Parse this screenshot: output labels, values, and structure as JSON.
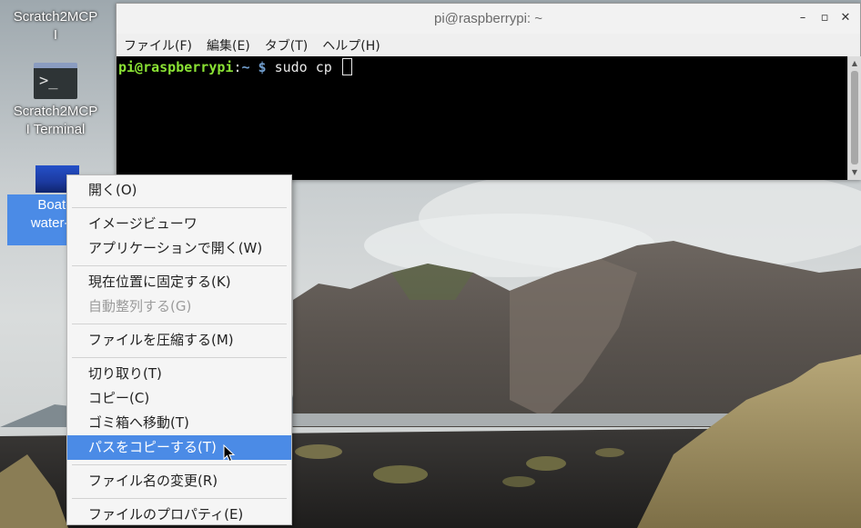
{
  "desktop": {
    "icons": [
      {
        "label": "Scratch2MCP\nI"
      },
      {
        "label": "Scratch2MCP\nI Terminal",
        "glyph": ">_"
      },
      {
        "label": "Boat-s\nwater-pa"
      }
    ]
  },
  "terminal": {
    "title": "pi@raspberrypi: ~",
    "controls": {
      "minimize": "–",
      "maximize": "▫",
      "close": "✕"
    },
    "menu": [
      "ファイル(F)",
      "編集(E)",
      "タブ(T)",
      "ヘルプ(H)"
    ],
    "prompt_user": "pi@raspberrypi",
    "prompt_sep": ":",
    "prompt_path": "~ $",
    "command": " sudo cp "
  },
  "context_menu": {
    "groups": [
      [
        {
          "label": "開く(O)"
        }
      ],
      [
        {
          "label": "イメージビューワ"
        },
        {
          "label": "アプリケーションで開く(W)"
        }
      ],
      [
        {
          "label": "現在位置に固定する(K)"
        },
        {
          "label": "自動整列する(G)",
          "disabled": true
        }
      ],
      [
        {
          "label": "ファイルを圧縮する(M)"
        }
      ],
      [
        {
          "label": "切り取り(T)"
        },
        {
          "label": "コピー(C)"
        },
        {
          "label": "ゴミ箱へ移動(T)"
        },
        {
          "label": "パスをコピーする(T)",
          "selected": true
        }
      ],
      [
        {
          "label": "ファイル名の変更(R)"
        }
      ],
      [
        {
          "label": "ファイルのプロパティ(E)"
        }
      ]
    ]
  },
  "colors": {
    "selection": "#4b8be6",
    "prompt_user": "#8ae234",
    "prompt_path": "#729fcf",
    "terminal_bg": "#000000"
  },
  "icons": [
    "terminal-icon",
    "image-thumbnail-icon",
    "mouse-pointer-icon"
  ]
}
